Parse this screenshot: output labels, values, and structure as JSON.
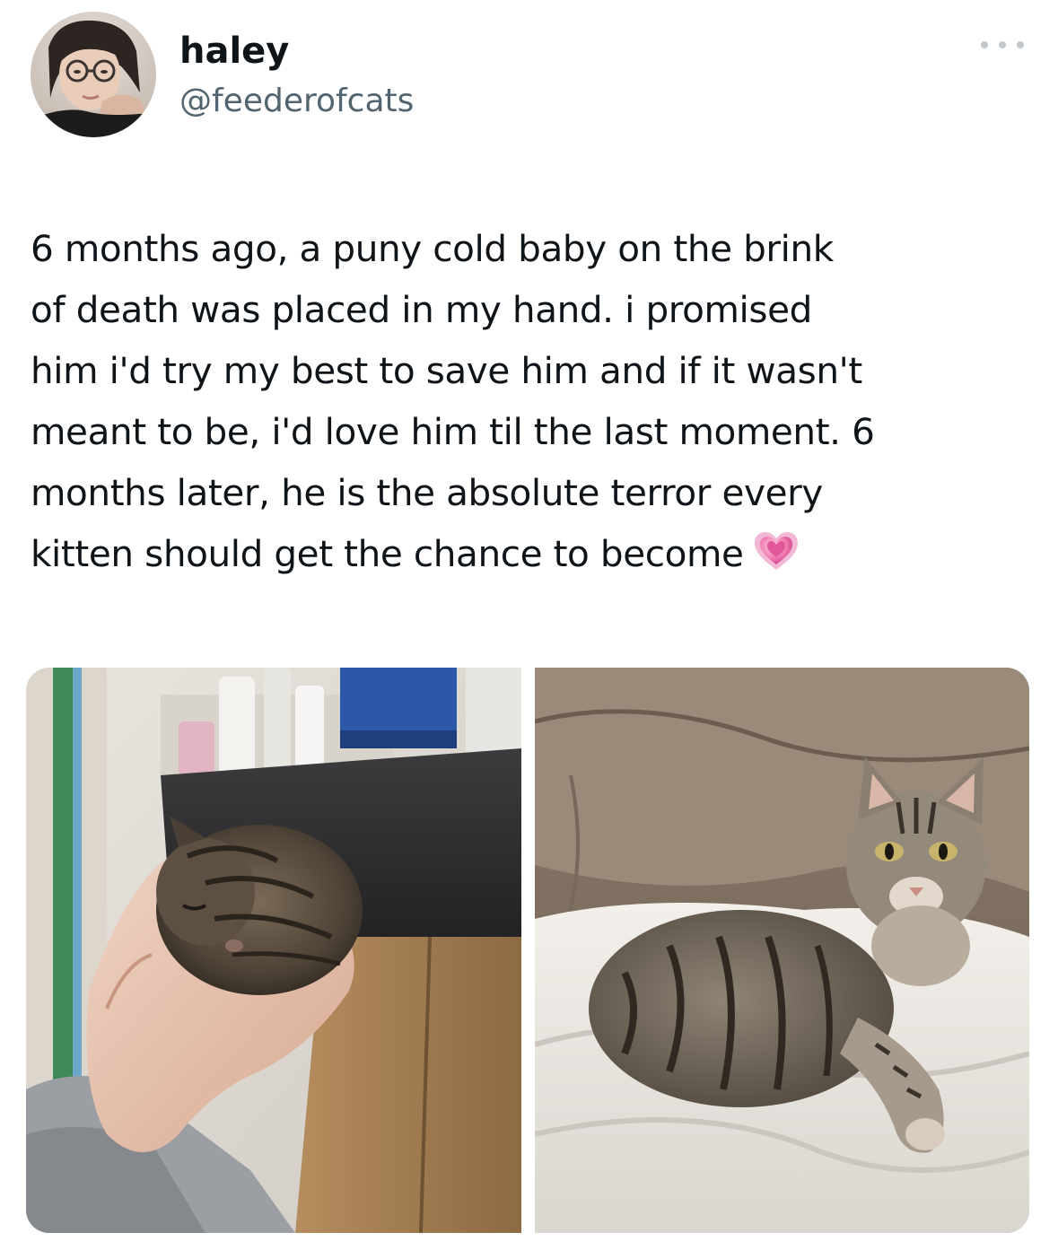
{
  "author": {
    "display_name": "haley",
    "handle": "@feederofcats",
    "avatar_icon": "profile-photo-avatar"
  },
  "more_icon": "more-dots-icon",
  "tweet": {
    "lines": [
      "6 months ago, a puny cold baby on the brink",
      "of death was placed in my hand. i promised",
      "him i'd try my best to save him and if it wasn't",
      "meant to be, i'd love him til the last moment. 6",
      "months later, he is the absolute terror every",
      "kitten should get the chance to become"
    ],
    "emoji": "growing-heart-emoji"
  },
  "media": [
    {
      "icon": "photo-kitten-in-hand"
    },
    {
      "icon": "photo-grown-cat-on-blanket"
    }
  ],
  "colors": {
    "name": "#0f1419",
    "handle": "#536471",
    "heart": "#e85a9a"
  }
}
